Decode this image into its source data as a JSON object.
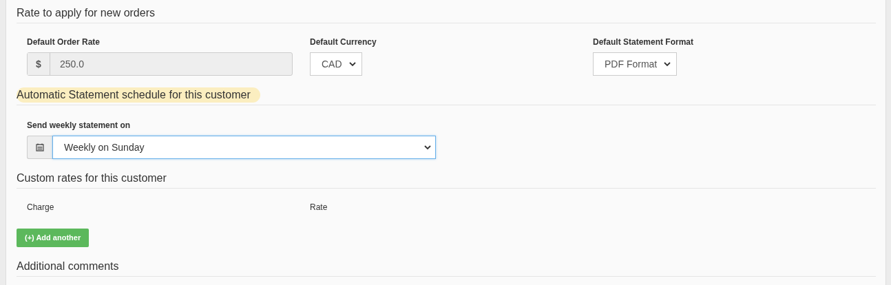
{
  "sections": [
    {
      "kind": "rates",
      "heading": "Rate to apply for new orders",
      "highlighted": false,
      "fields": [
        {
          "kind": "addon-input",
          "label": "Default Order Rate",
          "addon": "$",
          "value": "250.0",
          "disabled": true
        },
        {
          "kind": "select",
          "label": "Default Currency",
          "value": "CAD"
        },
        {
          "kind": "select",
          "label": "Default Statement Format",
          "value": "PDF Format"
        }
      ]
    },
    {
      "kind": "schedule",
      "heading": "Automatic Statement schedule for this customer",
      "highlighted": true,
      "fields": [
        {
          "kind": "calendar-select",
          "label": "Send weekly statement on",
          "value": "Weekly on Sunday",
          "focused": true
        }
      ]
    },
    {
      "kind": "custom",
      "heading": "Custom rates for this customer",
      "highlighted": false,
      "columns": [
        "Charge",
        "Rate"
      ],
      "button": "(+) Add another"
    },
    {
      "kind": "plain",
      "heading": "Additional comments",
      "highlighted": false
    }
  ]
}
